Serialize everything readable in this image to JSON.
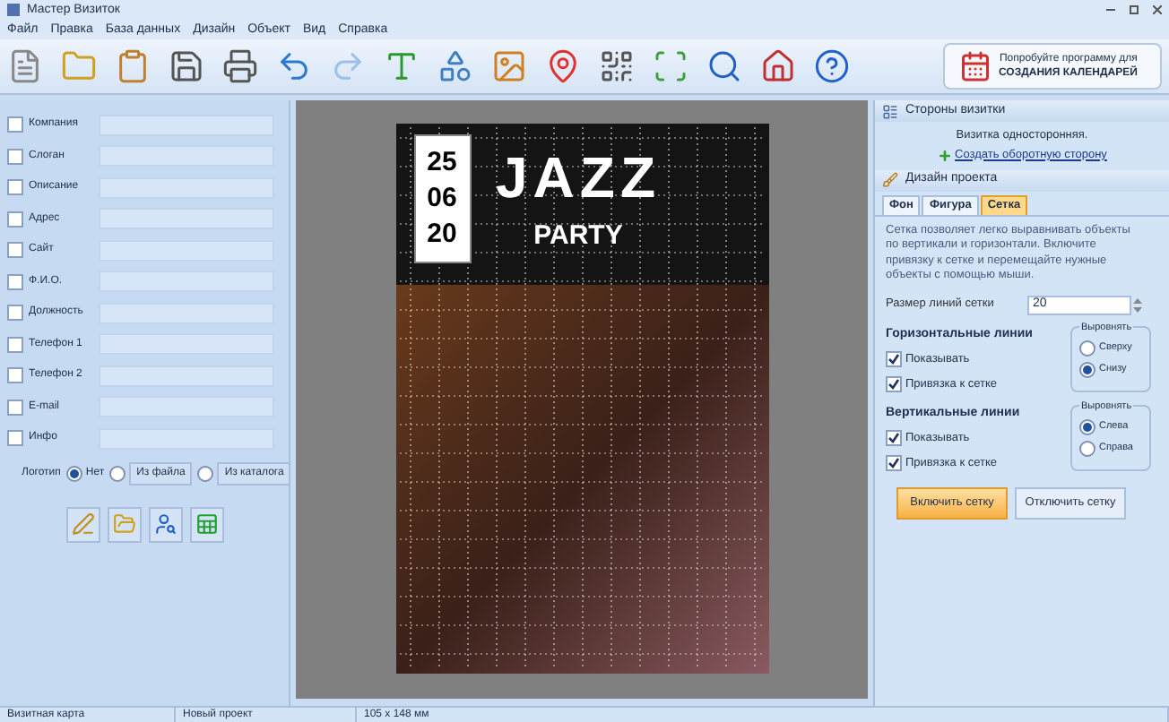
{
  "window": {
    "title": "Мастер Визиток"
  },
  "menu": [
    "Файл",
    "Правка",
    "База данных",
    "Дизайн",
    "Объект",
    "Вид",
    "Справка"
  ],
  "promo": {
    "line1": "Попробуйте программу для",
    "line2": "СОЗДАНИЯ КАЛЕНДАРЕЙ"
  },
  "fields": [
    {
      "label": "Компания",
      "checked": false
    },
    {
      "label": "Слоган",
      "checked": false
    },
    {
      "label": "Описание",
      "checked": false
    },
    {
      "label": "Адрес",
      "checked": false
    },
    {
      "label": "Сайт",
      "checked": false
    },
    {
      "label": "Ф.И.О.",
      "checked": false
    },
    {
      "label": "Должность",
      "checked": false
    },
    {
      "label": "Телефон 1",
      "checked": false
    },
    {
      "label": "Телефон 2",
      "checked": false
    },
    {
      "label": "E-mail",
      "checked": false
    },
    {
      "label": "Инфо",
      "checked": false
    }
  ],
  "logo": {
    "label": "Логотип",
    "options": [
      {
        "label": "Нет",
        "kind": "radio",
        "selected": true
      },
      {
        "label": "Из файла",
        "kind": "button",
        "selected": false
      },
      {
        "label": "Из каталога",
        "kind": "button",
        "selected": false
      }
    ]
  },
  "card": {
    "date": [
      "25",
      "06",
      "20"
    ],
    "title": "JAZZ",
    "subtitle": "PARTY"
  },
  "sides": {
    "header": "Стороны визитки",
    "text": "Визитка односторонняя.",
    "link": "Создать оборотную сторону"
  },
  "design": {
    "header": "Дизайн проекта",
    "tabs": [
      {
        "label": "Фон",
        "selected": false
      },
      {
        "label": "Фигура",
        "selected": false
      },
      {
        "label": "Сетка",
        "selected": true
      }
    ],
    "description": "Сетка позволяет легко выравнивать объекты по вертикали и горизонтали. Включите привязку к сетке и перемещайте нужные объекты с помощью мыши.",
    "size_label": "Размер линий сетки",
    "size_value": "20",
    "groups": [
      {
        "title": "Горизонтальные линии",
        "checks": [
          {
            "label": "Показывать",
            "checked": true
          },
          {
            "label": "Привязка к сетке",
            "checked": true
          }
        ],
        "align_title": "Выровнять",
        "align": [
          {
            "label": "Сверху",
            "selected": false
          },
          {
            "label": "Снизу",
            "selected": true
          }
        ]
      },
      {
        "title": "Вертикальные линии",
        "checks": [
          {
            "label": "Показывать",
            "checked": true
          },
          {
            "label": "Привязка к сетке",
            "checked": true
          }
        ],
        "align_title": "Выровнять",
        "align": [
          {
            "label": "Слева",
            "selected": true
          },
          {
            "label": "Справа",
            "selected": false
          }
        ]
      }
    ],
    "buttons": [
      {
        "label": "Включить сетку",
        "selected": true
      },
      {
        "label": "Отключить сетку",
        "selected": false
      }
    ]
  },
  "status_bar": [
    "Визитная карта",
    "Новый проект",
    "105 x 148 мм"
  ]
}
